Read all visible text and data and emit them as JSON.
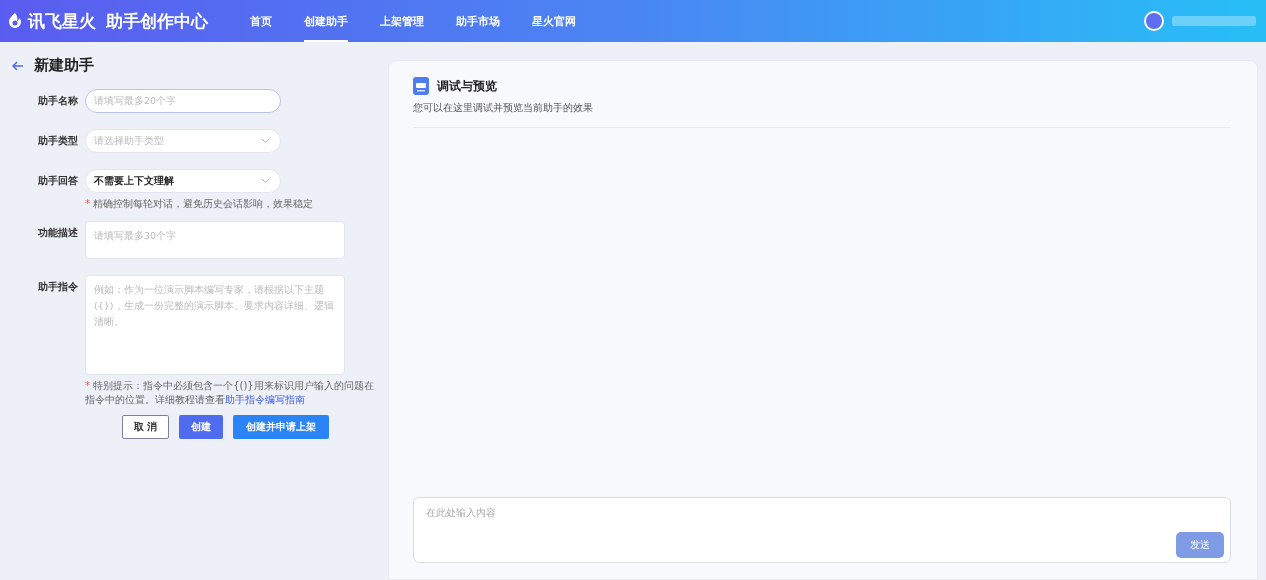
{
  "header": {
    "logo": "讯飞星火",
    "product": "助手创作中心",
    "nav": [
      {
        "label": "首页",
        "selected": false
      },
      {
        "label": "创建助手",
        "selected": true
      },
      {
        "label": "上架管理",
        "selected": false
      },
      {
        "label": "助手市场",
        "selected": false
      },
      {
        "label": "星火官网",
        "selected": false
      }
    ]
  },
  "form": {
    "title": "新建助手",
    "fields": [
      {
        "kind": "input",
        "label": "助手名称",
        "placeholder": "请填写最多20个字",
        "focused": true
      },
      {
        "kind": "select",
        "label": "助手类型",
        "placeholder": "请选择助手类型"
      },
      {
        "kind": "select",
        "label": "助手回答",
        "value": "不需要上下文理解",
        "hint_mark": "*",
        "hint": "精确控制每轮对话，避免历史会话影响，效果稳定"
      },
      {
        "kind": "textarea",
        "label": "功能描述",
        "placeholder": "请填写最多30个字"
      },
      {
        "kind": "bigtextarea",
        "label": "助手指令",
        "placeholder": "例如：作为一位演示脚本编写专家，请根据以下主题({})，生成一份完整的演示脚本。要求内容详细、逻辑清晰。",
        "hint_mark": "*",
        "hint": "特别提示：指令中必须包含一个{()}用来标识用户输入的问题在指令中的位置。详细教程请查看",
        "hint_link": "助手指令编写指南"
      }
    ],
    "buttons": [
      {
        "kind": "outline",
        "label": "取 消"
      },
      {
        "kind": "primary",
        "label": "创建"
      },
      {
        "kind": "blue",
        "label": "创建并申请上架"
      }
    ]
  },
  "preview": {
    "title": "调试与预览",
    "subtitle": "您可以在这里调试并预览当前助手的效果",
    "input_placeholder": "在此处输入内容",
    "send": "发送"
  }
}
